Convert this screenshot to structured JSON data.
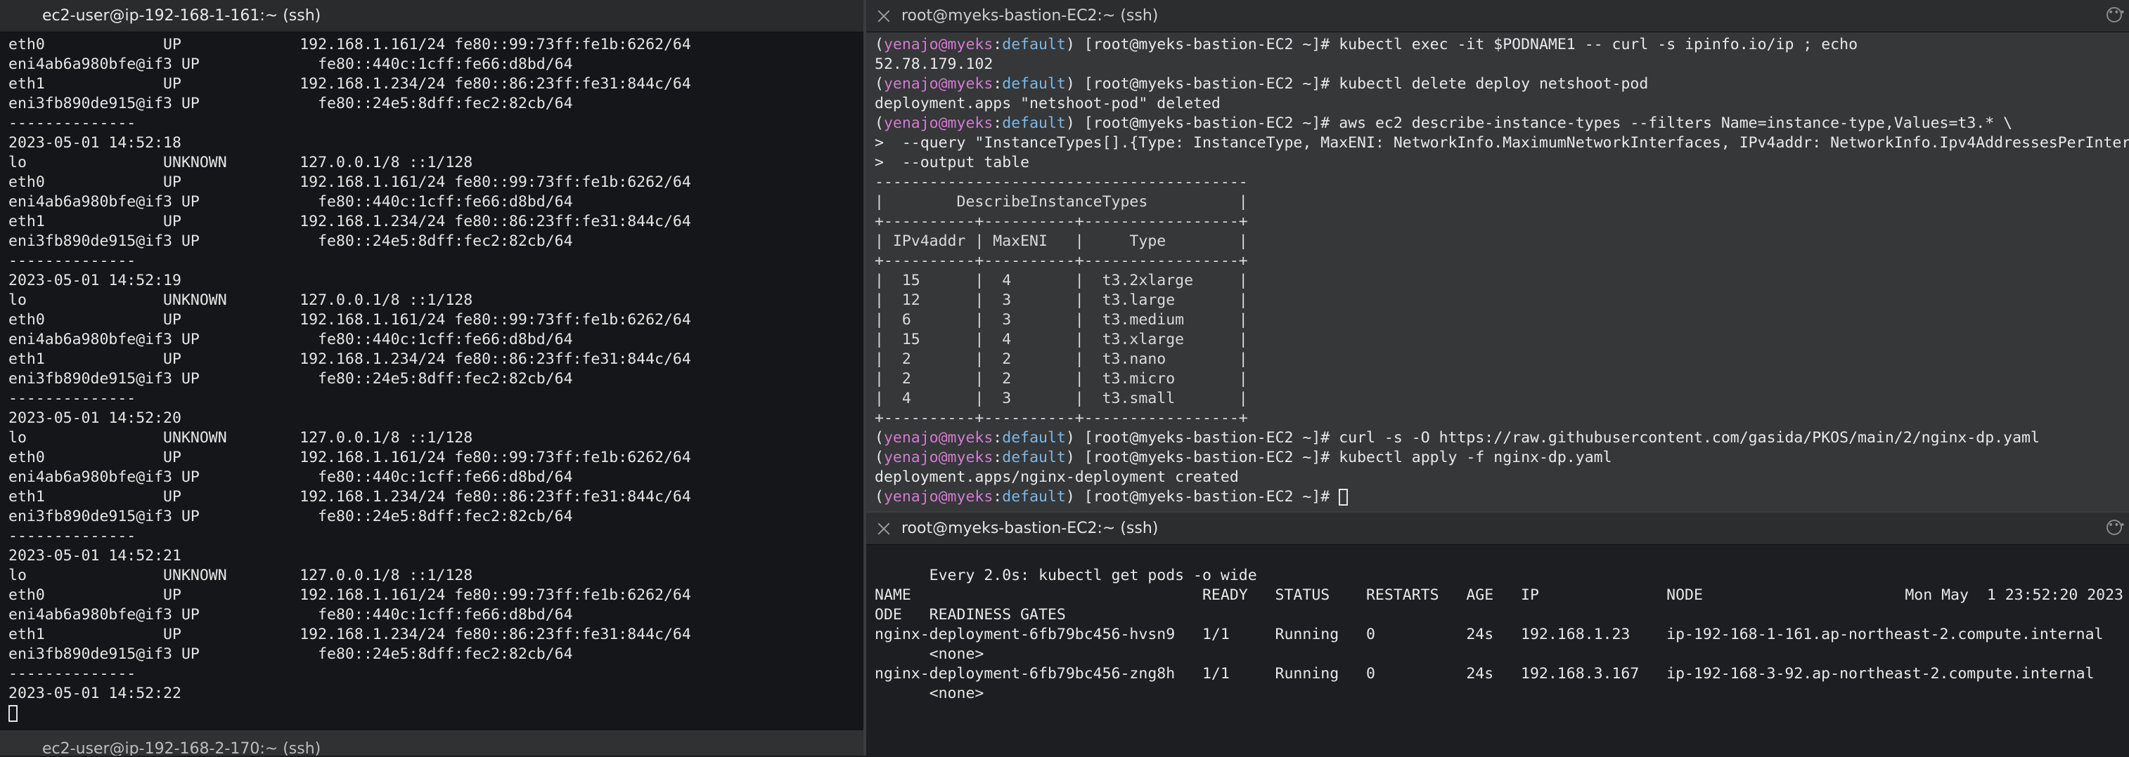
{
  "left_pane": {
    "title": "ec2-user@ip-192-168-1-161:~ (ssh)",
    "lines": [
      "eth0             UP             192.168.1.161/24 fe80::99:73ff:fe1b:6262/64",
      "eni4ab6a980bfe@if3 UP             fe80::440c:1cff:fe66:d8bd/64",
      "eth1             UP             192.168.1.234/24 fe80::86:23ff:fe31:844c/64",
      "eni3fb890de915@if3 UP             fe80::24e5:8dff:fec2:82cb/64",
      "--------------",
      "2023-05-01 14:52:18",
      "lo               UNKNOWN        127.0.0.1/8 ::1/128",
      "eth0             UP             192.168.1.161/24 fe80::99:73ff:fe1b:6262/64",
      "eni4ab6a980bfe@if3 UP             fe80::440c:1cff:fe66:d8bd/64",
      "eth1             UP             192.168.1.234/24 fe80::86:23ff:fe31:844c/64",
      "eni3fb890de915@if3 UP             fe80::24e5:8dff:fec2:82cb/64",
      "--------------",
      "2023-05-01 14:52:19",
      "lo               UNKNOWN        127.0.0.1/8 ::1/128",
      "eth0             UP             192.168.1.161/24 fe80::99:73ff:fe1b:6262/64",
      "eni4ab6a980bfe@if3 UP             fe80::440c:1cff:fe66:d8bd/64",
      "eth1             UP             192.168.1.234/24 fe80::86:23ff:fe31:844c/64",
      "eni3fb890de915@if3 UP             fe80::24e5:8dff:fec2:82cb/64",
      "--------------",
      "2023-05-01 14:52:20",
      "lo               UNKNOWN        127.0.0.1/8 ::1/128",
      "eth0             UP             192.168.1.161/24 fe80::99:73ff:fe1b:6262/64",
      "eni4ab6a980bfe@if3 UP             fe80::440c:1cff:fe66:d8bd/64",
      "eth1             UP             192.168.1.234/24 fe80::86:23ff:fe31:844c/64",
      "eni3fb890de915@if3 UP             fe80::24e5:8dff:fec2:82cb/64",
      "--------------",
      "2023-05-01 14:52:21",
      "lo               UNKNOWN        127.0.0.1/8 ::1/128",
      "eth0             UP             192.168.1.161/24 fe80::99:73ff:fe1b:6262/64",
      "eni4ab6a980bfe@if3 UP             fe80::440c:1cff:fe66:d8bd/64",
      "eth1             UP             192.168.1.234/24 fe80::86:23ff:fe31:844c/64",
      "eni3fb890de915@if3 UP             fe80::24e5:8dff:fec2:82cb/64",
      "--------------",
      "2023-05-01 14:52:22"
    ]
  },
  "left_bottom_pane": {
    "title": "ec2-user@ip-192-168-2-170:~ (ssh)"
  },
  "right_top_pane": {
    "title": "root@myeks-bastion-EC2:~ (ssh)",
    "prompt_user": "yenajo@myeks",
    "prompt_ctx": "default",
    "prompt_host": "[root@myeks-bastion-EC2 ~]#",
    "cmd1": "kubectl exec -it $PODNAME1 -- curl -s ipinfo.io/ip ; echo",
    "out1": "52.78.179.102",
    "cmd2": "kubectl delete deploy netshoot-pod",
    "out2": "deployment.apps \"netshoot-pod\" deleted",
    "cmd3": "aws ec2 describe-instance-types --filters Name=instance-type,Values=t3.* \\",
    "cmd3b": ">  --query \"InstanceTypes[].{Type: InstanceType, MaxENI: NetworkInfo.MaximumNetworkInterfaces, IPv4addr: NetworkInfo.Ipv4AddressesPerInterface}\" \\",
    "cmd3c": ">  --output table",
    "table_lines": [
      "-----------------------------------------",
      "|        DescribeInstanceTypes          |",
      "+----------+----------+-----------------+",
      "| IPv4addr | MaxENI   |     Type        |",
      "+----------+----------+-----------------+",
      "|  15      |  4       |  t3.2xlarge     |",
      "|  12      |  3       |  t3.large       |",
      "|  6       |  3       |  t3.medium      |",
      "|  15      |  4       |  t3.xlarge      |",
      "|  2       |  2       |  t3.nano        |",
      "|  2       |  2       |  t3.micro       |",
      "|  4       |  3       |  t3.small       |",
      "+----------+----------+-----------------+"
    ],
    "cmd4": "curl -s -O https://raw.githubusercontent.com/gasida/PKOS/main/2/nginx-dp.yaml",
    "cmd5": "kubectl apply -f nginx-dp.yaml",
    "out5": "deployment.apps/nginx-deployment created"
  },
  "right_bottom_pane": {
    "title": "root@myeks-bastion-EC2:~ (ssh)",
    "watch_line": "Every 2.0s: kubectl get pods -o wide",
    "clock": "Mon May  1 23:52:20 2023",
    "header1": "NAME                                READY   STATUS    RESTARTS   AGE   IP              NODE                                               NOMINATED N",
    "header2": "ODE   READINESS GATES",
    "row1": "nginx-deployment-6fb79bc456-hvsn9   1/1     Running   0          24s   192.168.1.23    ip-192-168-1-161.ap-northeast-2.compute.internal   <none>",
    "row1b": "      <none>",
    "row2": "nginx-deployment-6fb79bc456-zng8h   1/1     Running   0          24s   192.168.3.167   ip-192-168-3-92.ap-northeast-2.compute.internal    <none>",
    "row2b": "      <none>"
  }
}
